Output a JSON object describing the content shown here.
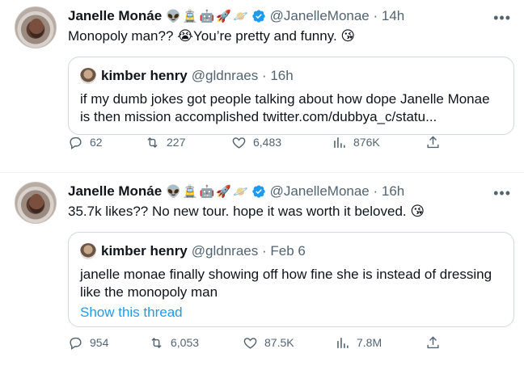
{
  "tweets": [
    {
      "author_name": "Janelle Monáe",
      "author_emojis": [
        "👽",
        "🚊",
        "🤖",
        "🚀",
        "🪐"
      ],
      "handle": "@JanelleMonae",
      "time": "· 14h",
      "text": "Monopoly man?? 😭You’re pretty and funny. 😘",
      "quote": {
        "author_name": "kimber henry",
        "handle": "@gldnraes",
        "time": "· 16h",
        "text": "if my dumb jokes got people talking about how dope Janelle Monae is then mission accomplished twitter.com/dubbya_c/statu..."
      },
      "actions": {
        "replies": "62",
        "retweets": "227",
        "likes": "6,483",
        "views": "876K"
      }
    },
    {
      "author_name": "Janelle Monáe",
      "author_emojis": [
        "👽",
        "🚊",
        "🤖",
        "🚀",
        "🪐"
      ],
      "handle": "@JanelleMonae",
      "time": "· 16h",
      "text": "35.7k likes?? No new tour. hope it was worth it beloved. 😘",
      "quote": {
        "author_name": "kimber henry",
        "handle": "@gldnraes",
        "time": "· Feb 6",
        "text": "janelle monae finally showing off how fine she is instead of dressing like the monopoly man",
        "show_thread": "Show this thread"
      },
      "actions": {
        "replies": "954",
        "retweets": "6,053",
        "likes": "87.5K",
        "views": "7.8M"
      }
    }
  ],
  "more_icon": "more-dots-icon",
  "colors": {
    "verified": "#1d9bf0",
    "secondary_text": "#536471",
    "link": "#1d9bf0",
    "border": "#cfd9de"
  }
}
